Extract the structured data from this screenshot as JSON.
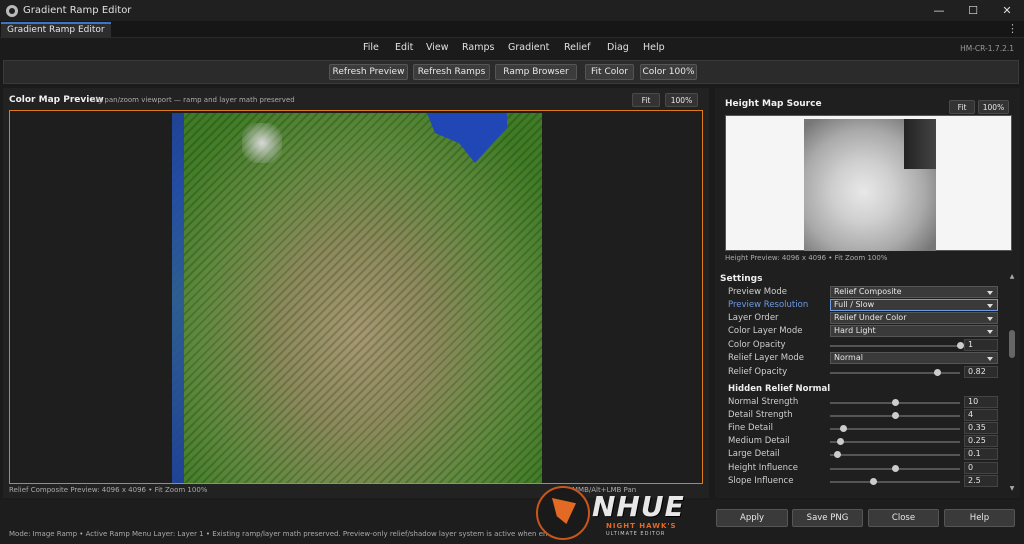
{
  "window": {
    "title": "Gradient Ramp Editor",
    "tab": "Gradient Ramp Editor",
    "minimize": "—",
    "maximize": "☐",
    "close": "✕",
    "more": "⋮"
  },
  "menu": [
    "File",
    "Edit",
    "View",
    "Ramps",
    "Gradient",
    "Relief",
    "Diag",
    "Help"
  ],
  "version": "HM-CR-1.7.2.1",
  "toolbar": {
    "refresh_preview": "Refresh Preview",
    "refresh_ramps": "Refresh Ramps",
    "ramp_browser": "Ramp Browser",
    "fit_color": "Fit Color",
    "color_100": "Color 100%"
  },
  "color_map": {
    "title": "Color Map Preview",
    "subtitle": "Big pan/zoom viewport — ramp and layer math preserved",
    "fit": "Fit",
    "zoom100": "100%",
    "status": "Relief Composite Preview: 4096 x 4096  •  Fit Zoom 100%",
    "status_right": "MMB/Alt+LMB Pan"
  },
  "height_map": {
    "title": "Height Map Source",
    "fit": "Fit",
    "zoom100": "100%",
    "caption": "Height Preview: 4096 x 4096  •  Fit Zoom 100%"
  },
  "settings": {
    "title": "Settings",
    "preview_mode": {
      "label": "Preview Mode",
      "value": "Relief Composite"
    },
    "preview_resolution": {
      "label": "Preview Resolution",
      "value": "Full / Slow"
    },
    "layer_order": {
      "label": "Layer Order",
      "value": "Relief Under Color"
    },
    "color_layer_mode": {
      "label": "Color Layer Mode",
      "value": "Hard Light"
    },
    "color_opacity": {
      "label": "Color Opacity",
      "value": "1",
      "fraction": 1.0
    },
    "relief_layer_mode": {
      "label": "Relief Layer Mode",
      "value": "Normal"
    },
    "relief_opacity": {
      "label": "Relief Opacity",
      "value": "0.82",
      "fraction": 0.82
    },
    "hidden_relief_title": "Hidden Relief Normal",
    "normal_strength": {
      "label": "Normal Strength",
      "value": "10",
      "fraction": 0.5
    },
    "detail_strength": {
      "label": "Detail Strength",
      "value": "4",
      "fraction": 0.5
    },
    "fine_detail": {
      "label": "Fine Detail",
      "value": "0.35",
      "fraction": 0.1
    },
    "medium_detail": {
      "label": "Medium Detail",
      "value": "0.25",
      "fraction": 0.08
    },
    "large_detail": {
      "label": "Large Detail",
      "value": "0.1",
      "fraction": 0.05
    },
    "height_influence": {
      "label": "Height Influence",
      "value": "0",
      "fraction": 0.5
    },
    "slope_influence": {
      "label": "Slope Influence",
      "value": "2.5",
      "fraction": 0.33
    }
  },
  "footer": {
    "status": "Mode: Image Ramp  •  Active Ramp Menu Layer: Layer 1  •  Existing ramp/layer math preserved. Preview-only relief/shadow layer system is active when enabled.",
    "apply": "Apply",
    "save_png": "Save PNG",
    "close": "Close",
    "help": "Help"
  },
  "logo": {
    "brand": "NHUE",
    "tag1": "NIGHT HAWK'S",
    "tag2": "ULTIMATE EDITOR"
  }
}
